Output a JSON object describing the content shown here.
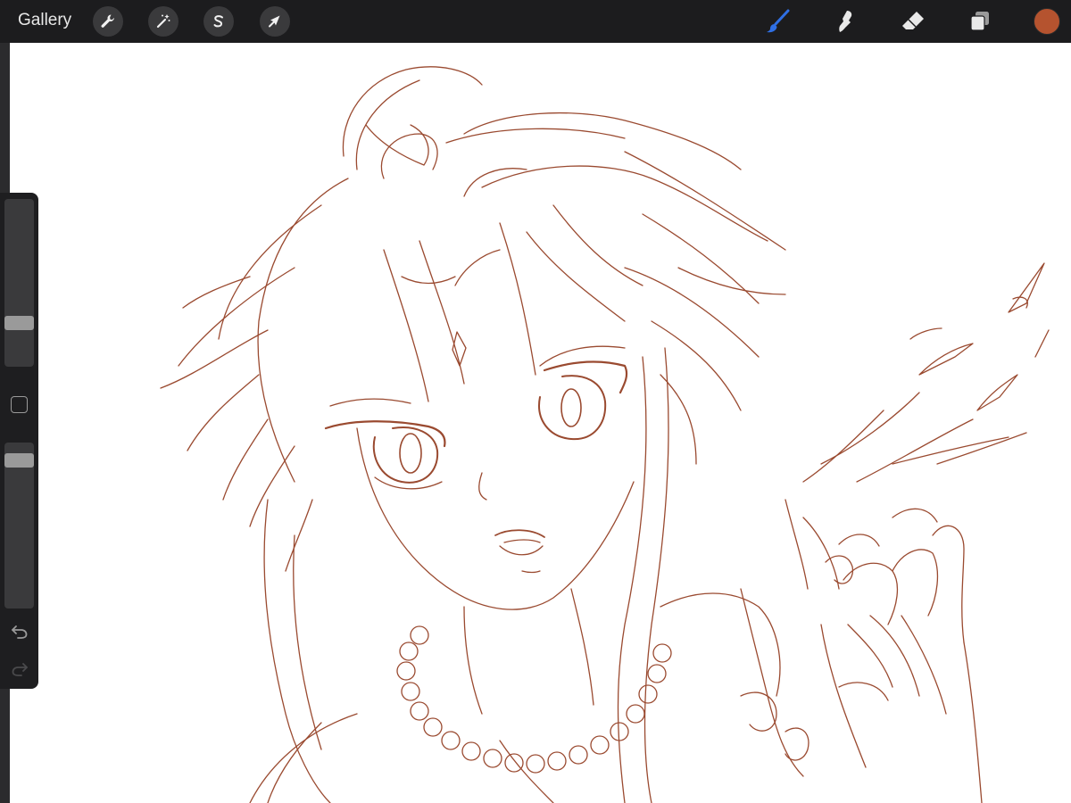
{
  "toolbar": {
    "gallery_label": "Gallery",
    "left_tools": [
      "wrench-icon",
      "magic-wand-icon",
      "selection-s-icon",
      "transform-arrow-icon"
    ],
    "right_tools": [
      "brush-icon",
      "smudge-icon",
      "eraser-icon",
      "layers-icon"
    ],
    "active_tool": "brush-icon",
    "active_tool_color": "#2f6fe4",
    "current_color": "#b5532f"
  },
  "sidebar": {
    "brush_size_level": 0.24,
    "brush_opacity_level": 0.07
  },
  "canvas": {
    "background": "#ffffff",
    "stroke_color": "#9a4a30"
  }
}
